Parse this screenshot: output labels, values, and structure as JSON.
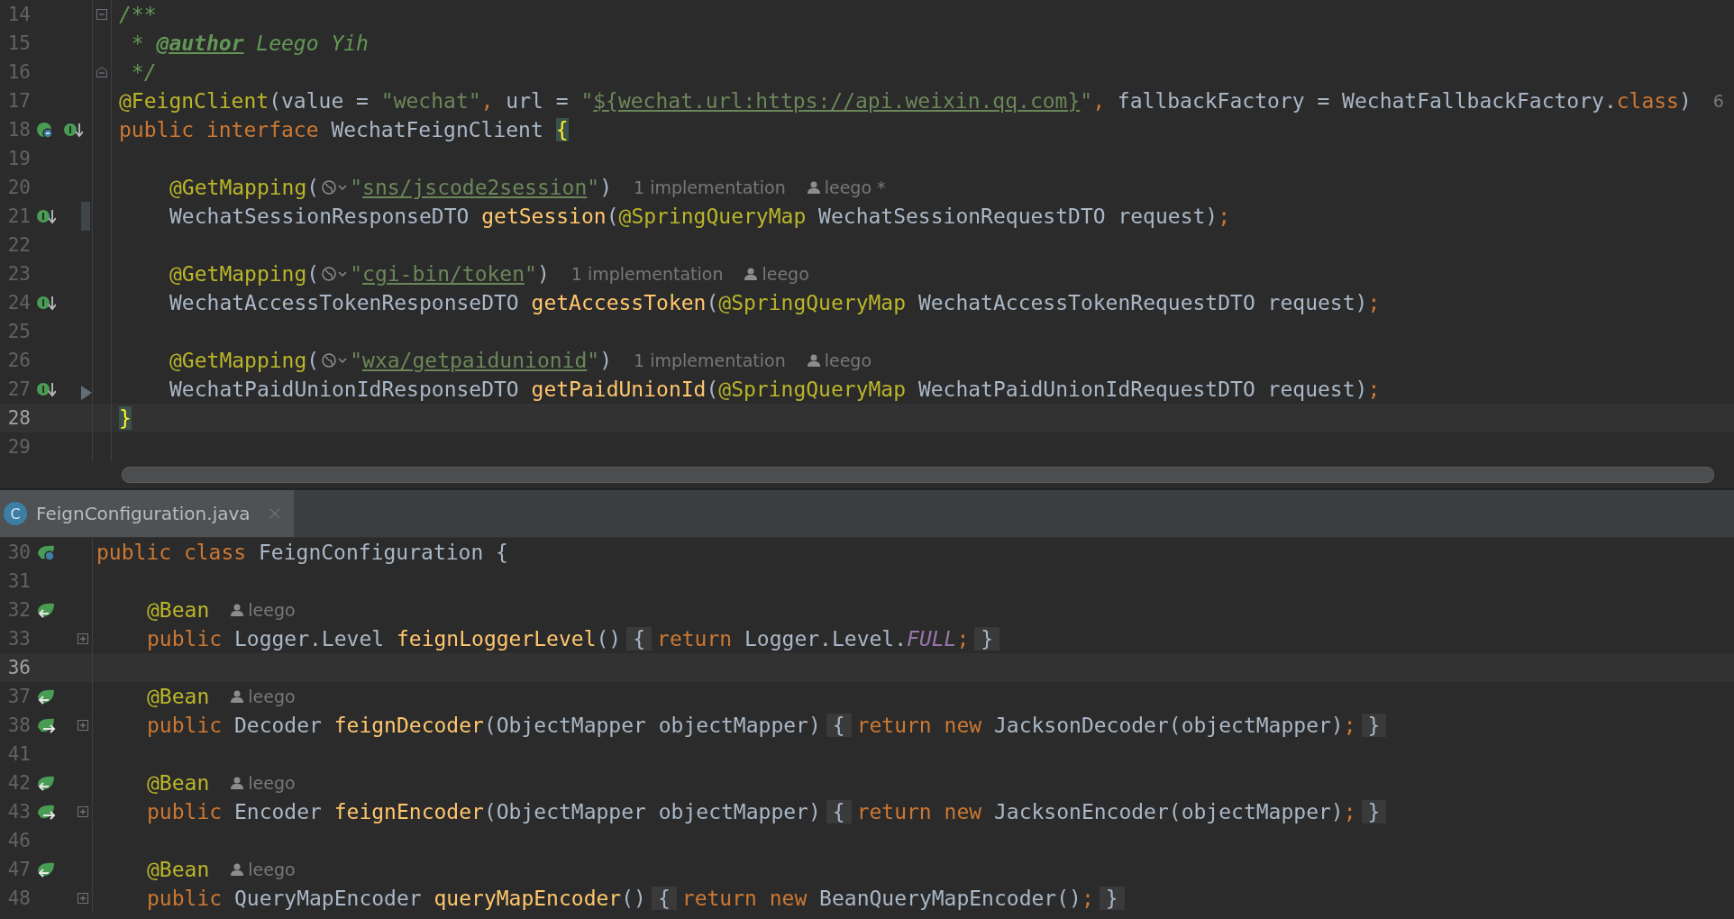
{
  "top_editor": {
    "lines": [
      {
        "number": "14",
        "current": false,
        "fold": {
          "kind": "start"
        },
        "items": [
          {
            "kind": "code",
            "parts": [
              {
                "kind": "comment",
                "t": "/**"
              }
            ]
          }
        ]
      },
      {
        "number": "15",
        "current": false,
        "items": [
          {
            "kind": "code",
            "parts": [
              {
                "kind": "comment",
                "t": " * "
              },
              {
                "kind": "doctag",
                "t": "@author"
              },
              {
                "kind": "comment",
                "t": " Leego Yih"
              }
            ]
          }
        ]
      },
      {
        "number": "16",
        "current": false,
        "fold": {
          "kind": "end"
        },
        "items": [
          {
            "kind": "code",
            "parts": [
              {
                "kind": "comment",
                "t": " */"
              }
            ]
          }
        ]
      },
      {
        "number": "17",
        "current": false,
        "items": [
          {
            "kind": "code",
            "parts": [
              {
                "kind": "ann",
                "t": "@FeignClient"
              },
              {
                "kind": "plain",
                "t": "(value = "
              },
              {
                "kind": "str",
                "t": "\"wechat\""
              },
              {
                "kind": "kw",
                "t": ","
              },
              {
                "kind": "plain",
                "t": " url = "
              },
              {
                "kind": "str",
                "t": "\""
              },
              {
                "kind": "link",
                "t": "${wechat.url:https://api.weixin.qq.com}"
              },
              {
                "kind": "str",
                "t": "\""
              },
              {
                "kind": "kw",
                "t": ","
              },
              {
                "kind": "plain",
                "t": " fallbackFactory = WechatFallbackFactory."
              },
              {
                "kind": "kw",
                "t": "class"
              },
              {
                "kind": "plain",
                "t": ")"
              }
            ]
          },
          {
            "kind": "usages",
            "text": "6"
          }
        ]
      },
      {
        "number": "18",
        "current": false,
        "gutter": [
          {
            "kind": "interface"
          },
          {
            "kind": "implemented"
          }
        ],
        "items": [
          {
            "kind": "code",
            "parts": [
              {
                "kind": "kw",
                "t": "public interface "
              },
              {
                "kind": "plain",
                "t": "WechatFeignClient "
              },
              {
                "kind": "brace",
                "t": "{"
              }
            ]
          }
        ]
      },
      {
        "number": "19",
        "current": false
      },
      {
        "number": "20",
        "current": false,
        "indent": true,
        "items": [
          {
            "kind": "code",
            "parts": [
              {
                "kind": "ann",
                "t": "@GetMapping"
              },
              {
                "kind": "plain",
                "t": "("
              }
            ]
          },
          {
            "kind": "globe"
          },
          {
            "kind": "code",
            "parts": [
              {
                "kind": "str",
                "t": "\""
              },
              {
                "kind": "link",
                "t": "sns/jscode2session"
              },
              {
                "kind": "str",
                "t": "\""
              },
              {
                "kind": "plain",
                "t": ")"
              }
            ]
          },
          {
            "kind": "usages",
            "text": "1 implementation"
          },
          {
            "kind": "author",
            "text": "leego *"
          }
        ]
      },
      {
        "number": "21",
        "current": false,
        "vcs": {
          "kind": "modified"
        },
        "gutter": [
          {
            "kind": "implemented"
          }
        ],
        "indent": true,
        "items": [
          {
            "kind": "code",
            "parts": [
              {
                "kind": "plain",
                "t": "WechatSessionResponseDTO "
              },
              {
                "kind": "decl",
                "t": "getSession"
              },
              {
                "kind": "plain",
                "t": "("
              },
              {
                "kind": "ann",
                "t": "@SpringQueryMap"
              },
              {
                "kind": "plain",
                "t": " WechatSessionRequestDTO request)"
              },
              {
                "kind": "kw",
                "t": ";"
              }
            ]
          }
        ]
      },
      {
        "number": "22",
        "current": false
      },
      {
        "number": "23",
        "current": false,
        "indent": true,
        "items": [
          {
            "kind": "code",
            "parts": [
              {
                "kind": "ann",
                "t": "@GetMapping"
              },
              {
                "kind": "plain",
                "t": "("
              }
            ]
          },
          {
            "kind": "globe"
          },
          {
            "kind": "code",
            "parts": [
              {
                "kind": "str",
                "t": "\""
              },
              {
                "kind": "link",
                "t": "cgi-bin/token"
              },
              {
                "kind": "str",
                "t": "\""
              },
              {
                "kind": "plain",
                "t": ")"
              }
            ]
          },
          {
            "kind": "usages",
            "text": "1 implementation"
          },
          {
            "kind": "author",
            "text": "leego"
          }
        ]
      },
      {
        "number": "24",
        "current": false,
        "gutter": [
          {
            "kind": "implemented"
          }
        ],
        "indent": true,
        "items": [
          {
            "kind": "code",
            "parts": [
              {
                "kind": "plain",
                "t": "WechatAccessTokenResponseDTO "
              },
              {
                "kind": "decl",
                "t": "getAccessToken"
              },
              {
                "kind": "plain",
                "t": "("
              },
              {
                "kind": "ann",
                "t": "@SpringQueryMap"
              },
              {
                "kind": "plain",
                "t": " WechatAccessTokenRequestDTO request)"
              },
              {
                "kind": "kw",
                "t": ";"
              }
            ]
          }
        ]
      },
      {
        "number": "25",
        "current": false
      },
      {
        "number": "26",
        "current": false,
        "indent": true,
        "items": [
          {
            "kind": "code",
            "parts": [
              {
                "kind": "ann",
                "t": "@GetMapping"
              },
              {
                "kind": "plain",
                "t": "("
              }
            ]
          },
          {
            "kind": "globe"
          },
          {
            "kind": "code",
            "parts": [
              {
                "kind": "str",
                "t": "\""
              },
              {
                "kind": "link",
                "t": "wxa/getpaidunionid"
              },
              {
                "kind": "str",
                "t": "\""
              },
              {
                "kind": "plain",
                "t": ")"
              }
            ]
          },
          {
            "kind": "usages",
            "text": "1 implementation"
          },
          {
            "kind": "author",
            "text": "leego"
          }
        ]
      },
      {
        "number": "27",
        "current": false,
        "vcs": {
          "kind": "deleted"
        },
        "gutter": [
          {
            "kind": "implemented"
          }
        ],
        "indent": true,
        "items": [
          {
            "kind": "code",
            "parts": [
              {
                "kind": "plain",
                "t": "WechatPaidUnionIdResponseDTO "
              },
              {
                "kind": "decl",
                "t": "getPaidUnionId"
              },
              {
                "kind": "plain",
                "t": "("
              },
              {
                "kind": "ann",
                "t": "@SpringQueryMap"
              },
              {
                "kind": "plain",
                "t": " WechatPaidUnionIdRequestDTO request)"
              },
              {
                "kind": "kw",
                "t": ";"
              }
            ]
          }
        ]
      },
      {
        "number": "28",
        "current": true,
        "items": [
          {
            "kind": "code",
            "parts": [
              {
                "kind": "brace",
                "t": "}"
              }
            ]
          }
        ]
      },
      {
        "number": "29",
        "current": false
      }
    ]
  },
  "tab": {
    "icon_letter": "C",
    "label": "FeignConfiguration.java",
    "selected": true
  },
  "bottom_editor": {
    "lines": [
      {
        "number": "30",
        "current": false,
        "gutter": [
          {
            "kind": "bean-class"
          }
        ],
        "items": [
          {
            "kind": "code",
            "parts": [
              {
                "kind": "kw",
                "t": "public class "
              },
              {
                "kind": "plain",
                "t": "FeignConfiguration {"
              }
            ]
          }
        ]
      },
      {
        "number": "31",
        "current": false
      },
      {
        "number": "32",
        "current": false,
        "gutter": [
          {
            "kind": "bean-in"
          }
        ],
        "indent": true,
        "items": [
          {
            "kind": "code",
            "parts": [
              {
                "kind": "ann",
                "t": "@Bean"
              }
            ]
          },
          {
            "kind": "author",
            "text": "leego"
          }
        ]
      },
      {
        "number": "33",
        "current": false,
        "fold": {
          "kind": "plus"
        },
        "indent": true,
        "items": [
          {
            "kind": "code",
            "parts": [
              {
                "kind": "kw",
                "t": "public "
              },
              {
                "kind": "plain",
                "t": "Logger.Level "
              },
              {
                "kind": "decl",
                "t": "feignLoggerLevel"
              },
              {
                "kind": "plain",
                "t": "()"
              },
              {
                "kind": "fold",
                "t": "{"
              },
              {
                "kind": "kw",
                "t": "return"
              },
              {
                "kind": "plain",
                "t": " Logger.Level."
              },
              {
                "kind": "const",
                "t": "FULL"
              },
              {
                "kind": "kw",
                "t": ";"
              },
              {
                "kind": "fold",
                "t": "}"
              }
            ]
          }
        ]
      },
      {
        "number": "36",
        "current": true
      },
      {
        "number": "37",
        "current": false,
        "gutter": [
          {
            "kind": "bean-in"
          }
        ],
        "indent": true,
        "items": [
          {
            "kind": "code",
            "parts": [
              {
                "kind": "ann",
                "t": "@Bean"
              }
            ]
          },
          {
            "kind": "author",
            "text": "leego"
          }
        ]
      },
      {
        "number": "38",
        "current": false,
        "gutter": [
          {
            "kind": "bean-out"
          }
        ],
        "fold": {
          "kind": "plus"
        },
        "indent": true,
        "items": [
          {
            "kind": "code",
            "parts": [
              {
                "kind": "kw",
                "t": "public "
              },
              {
                "kind": "plain",
                "t": "Decoder "
              },
              {
                "kind": "decl",
                "t": "feignDecoder"
              },
              {
                "kind": "plain",
                "t": "(ObjectMapper objectMapper)"
              },
              {
                "kind": "fold",
                "t": "{"
              },
              {
                "kind": "kw",
                "t": "return new "
              },
              {
                "kind": "plain",
                "t": "JacksonDecoder(objectMapper)"
              },
              {
                "kind": "kw",
                "t": ";"
              },
              {
                "kind": "fold",
                "t": "}"
              }
            ]
          }
        ]
      },
      {
        "number": "41",
        "current": false
      },
      {
        "number": "42",
        "current": false,
        "gutter": [
          {
            "kind": "bean-in"
          }
        ],
        "indent": true,
        "items": [
          {
            "kind": "code",
            "parts": [
              {
                "kind": "ann",
                "t": "@Bean"
              }
            ]
          },
          {
            "kind": "author",
            "text": "leego"
          }
        ]
      },
      {
        "number": "43",
        "current": false,
        "gutter": [
          {
            "kind": "bean-out"
          }
        ],
        "fold": {
          "kind": "plus"
        },
        "indent": true,
        "items": [
          {
            "kind": "code",
            "parts": [
              {
                "kind": "kw",
                "t": "public "
              },
              {
                "kind": "plain",
                "t": "Encoder "
              },
              {
                "kind": "decl",
                "t": "feignEncoder"
              },
              {
                "kind": "plain",
                "t": "(ObjectMapper objectMapper)"
              },
              {
                "kind": "fold",
                "t": "{"
              },
              {
                "kind": "kw",
                "t": "return new "
              },
              {
                "kind": "plain",
                "t": "JacksonEncoder(objectMapper)"
              },
              {
                "kind": "kw",
                "t": ";"
              },
              {
                "kind": "fold",
                "t": "}"
              }
            ]
          }
        ]
      },
      {
        "number": "46",
        "current": false
      },
      {
        "number": "47",
        "current": false,
        "gutter": [
          {
            "kind": "bean-in"
          }
        ],
        "indent": true,
        "items": [
          {
            "kind": "code",
            "parts": [
              {
                "kind": "ann",
                "t": "@Bean"
              }
            ]
          },
          {
            "kind": "author",
            "text": "leego"
          }
        ]
      },
      {
        "number": "48",
        "current": false,
        "fold": {
          "kind": "plus"
        },
        "indent": true,
        "items": [
          {
            "kind": "code",
            "parts": [
              {
                "kind": "kw",
                "t": "public "
              },
              {
                "kind": "plain",
                "t": "QueryMapEncoder "
              },
              {
                "kind": "decl",
                "t": "queryMapEncoder"
              },
              {
                "kind": "plain",
                "t": "()"
              },
              {
                "kind": "fold",
                "t": "{"
              },
              {
                "kind": "kw",
                "t": "return new "
              },
              {
                "kind": "plain",
                "t": "BeanQueryMapEncoder()"
              },
              {
                "kind": "kw",
                "t": ";"
              },
              {
                "kind": "fold",
                "t": "}"
              }
            ]
          }
        ]
      }
    ]
  }
}
